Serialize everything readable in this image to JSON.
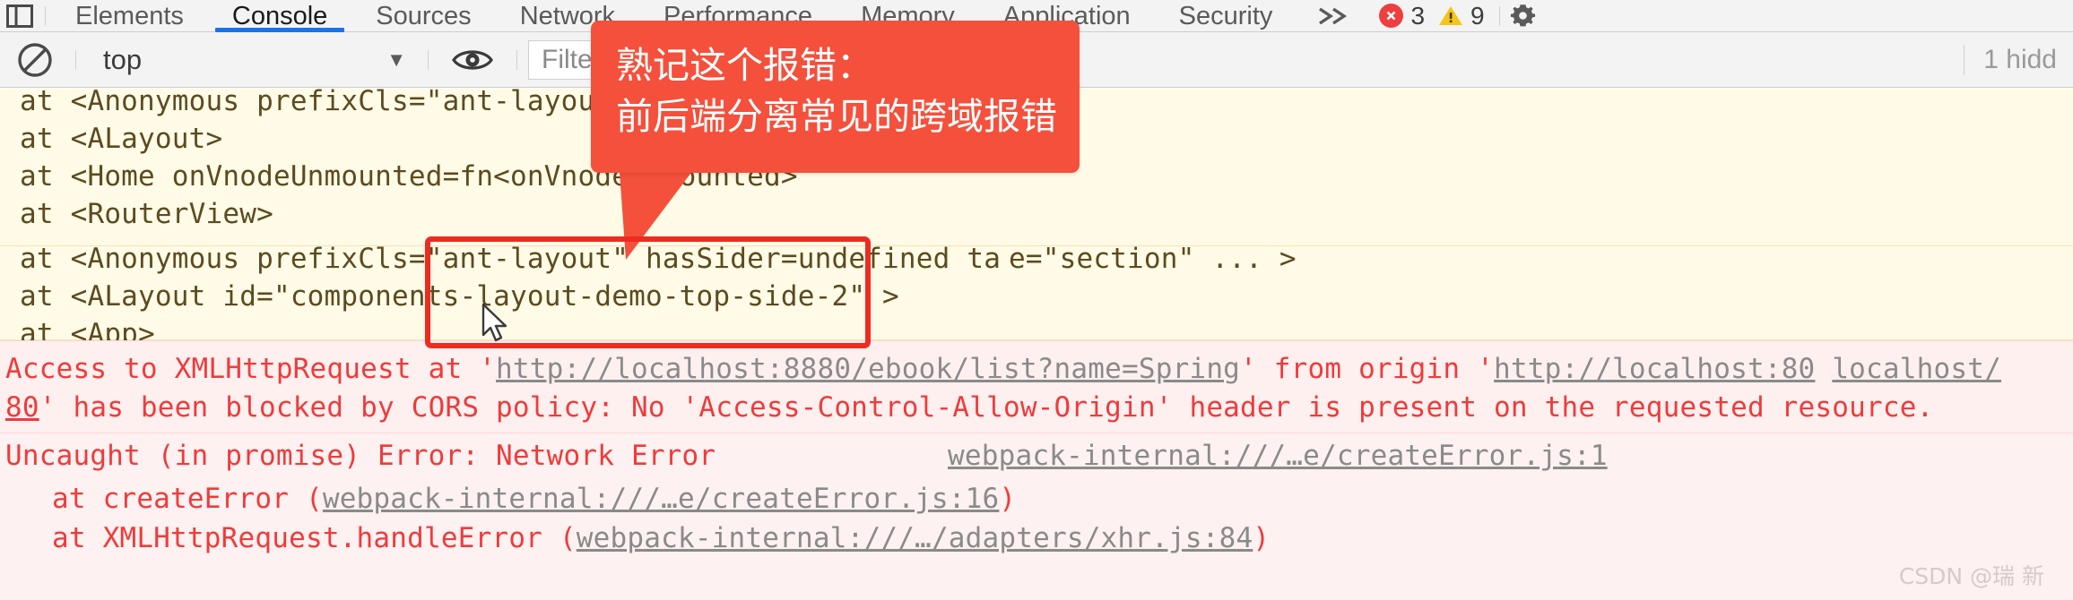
{
  "tabstrip": {
    "panel_icon": "inspect-panel-icon",
    "tabs": [
      {
        "label": "Elements",
        "selected": false
      },
      {
        "label": "Console",
        "selected": true
      },
      {
        "label": "Sources",
        "selected": false
      },
      {
        "label": "Network",
        "selected": false
      },
      {
        "label": "Performance",
        "selected": false
      },
      {
        "label": "Memory",
        "selected": false
      },
      {
        "label": "Application",
        "selected": false
      },
      {
        "label": "Security",
        "selected": false
      }
    ],
    "more_tabs_icon": "double-chevron-right-icon",
    "error_count": "3",
    "warning_count": "9",
    "settings_icon": "gear-icon"
  },
  "filterbar": {
    "clear_icon": "clear-console-icon",
    "context_value": "top",
    "context_caret": "▼",
    "eye_icon": "eye-icon",
    "filter_placeholder": "Filter",
    "hidden_message": "1 hidd"
  },
  "console": {
    "warning_stack": [
      "at <Anonymous prefixCls=\"ant-layout\" hasSider=u",
      "at <ALayout>",
      "at <Home onVnodeUnmounted=fn<onVnodeUnmounted>",
      "at <RouterView>",
      "at <Anonymous prefixCls=\"ant-layout\" hasSider=undefined ta",
      "e=\"section\"   ... >",
      "at <ALayout id=\"components-layout-demo-top-side-2\" >",
      "at <App>"
    ],
    "cors_error": {
      "prefix": "Access to XMLHttpRequest at '",
      "request_url": "http://localhost:8880/ebook/list?name=Spring",
      "mid": "' from origin '",
      "origin_url": "http://localhost:80",
      "origin_url2": "localhost/",
      "line2_prefix": "80",
      "line2_rest": "' has been blocked by CORS policy: No 'Access-Control-Allow-Origin' header is present on the requested resource."
    },
    "network_error": {
      "headline": "Uncaught (in promise) Error: Network Error",
      "source_link": "webpack-internal:///…e/createError.js:1",
      "frames": [
        {
          "text": "at createError (",
          "link": "webpack-internal:///…e/createError.js:16",
          "suffix": ")"
        },
        {
          "text": "at XMLHttpRequest.handleError (",
          "link": "webpack-internal:///…/adapters/xhr.js:84",
          "suffix": ")"
        }
      ]
    }
  },
  "annotation": {
    "callout_line1": "熟记这个报错：",
    "callout_line2": "前后端分离常见的跨域报错",
    "callout_color": "#f4503c",
    "highlight_color": "#ef2b21"
  },
  "watermark": {
    "text": "CSDN @瑞 新"
  }
}
